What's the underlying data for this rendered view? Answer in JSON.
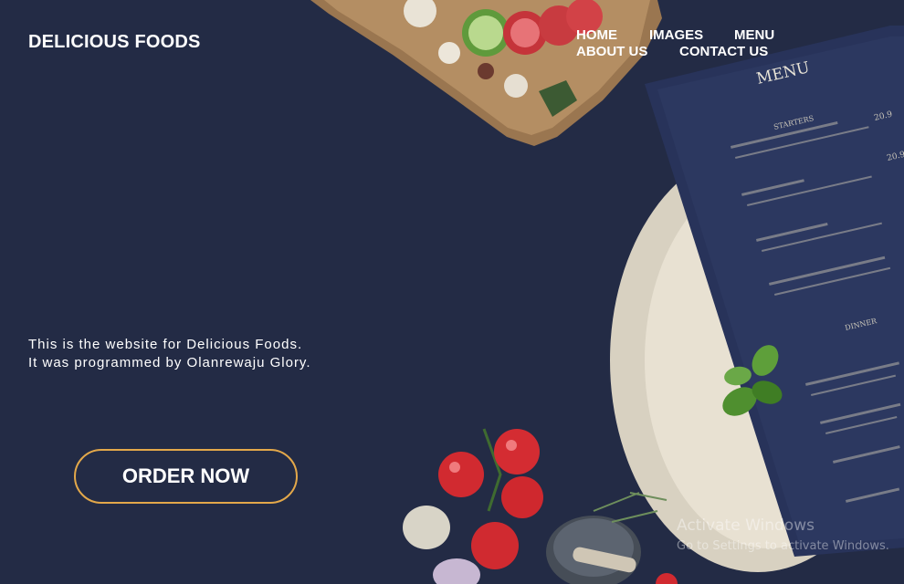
{
  "brand": {
    "name": "DELICIOUS FOODS"
  },
  "nav": {
    "items": [
      {
        "label": "HOME"
      },
      {
        "label": "IMAGES"
      },
      {
        "label": "MENU"
      },
      {
        "label": "ABOUT US"
      },
      {
        "label": "CONTACT US"
      }
    ]
  },
  "hero": {
    "line1": "This is the website for Delicious Foods.",
    "line2": "It was programmed by Olanrewaju Glory.",
    "order_button": "ORDER NOW"
  },
  "menu_card": {
    "title": "MENU",
    "starters_heading": "STARTERS",
    "dinner_heading": "DINNER",
    "price_1": "20.9",
    "price_2": "20.9"
  },
  "watermark": {
    "title": "Activate Windows",
    "subtitle": "Go to Settings to activate Windows."
  },
  "colors": {
    "background": "#232b45",
    "button_border": "#e3a84a",
    "text": "#ffffff"
  }
}
